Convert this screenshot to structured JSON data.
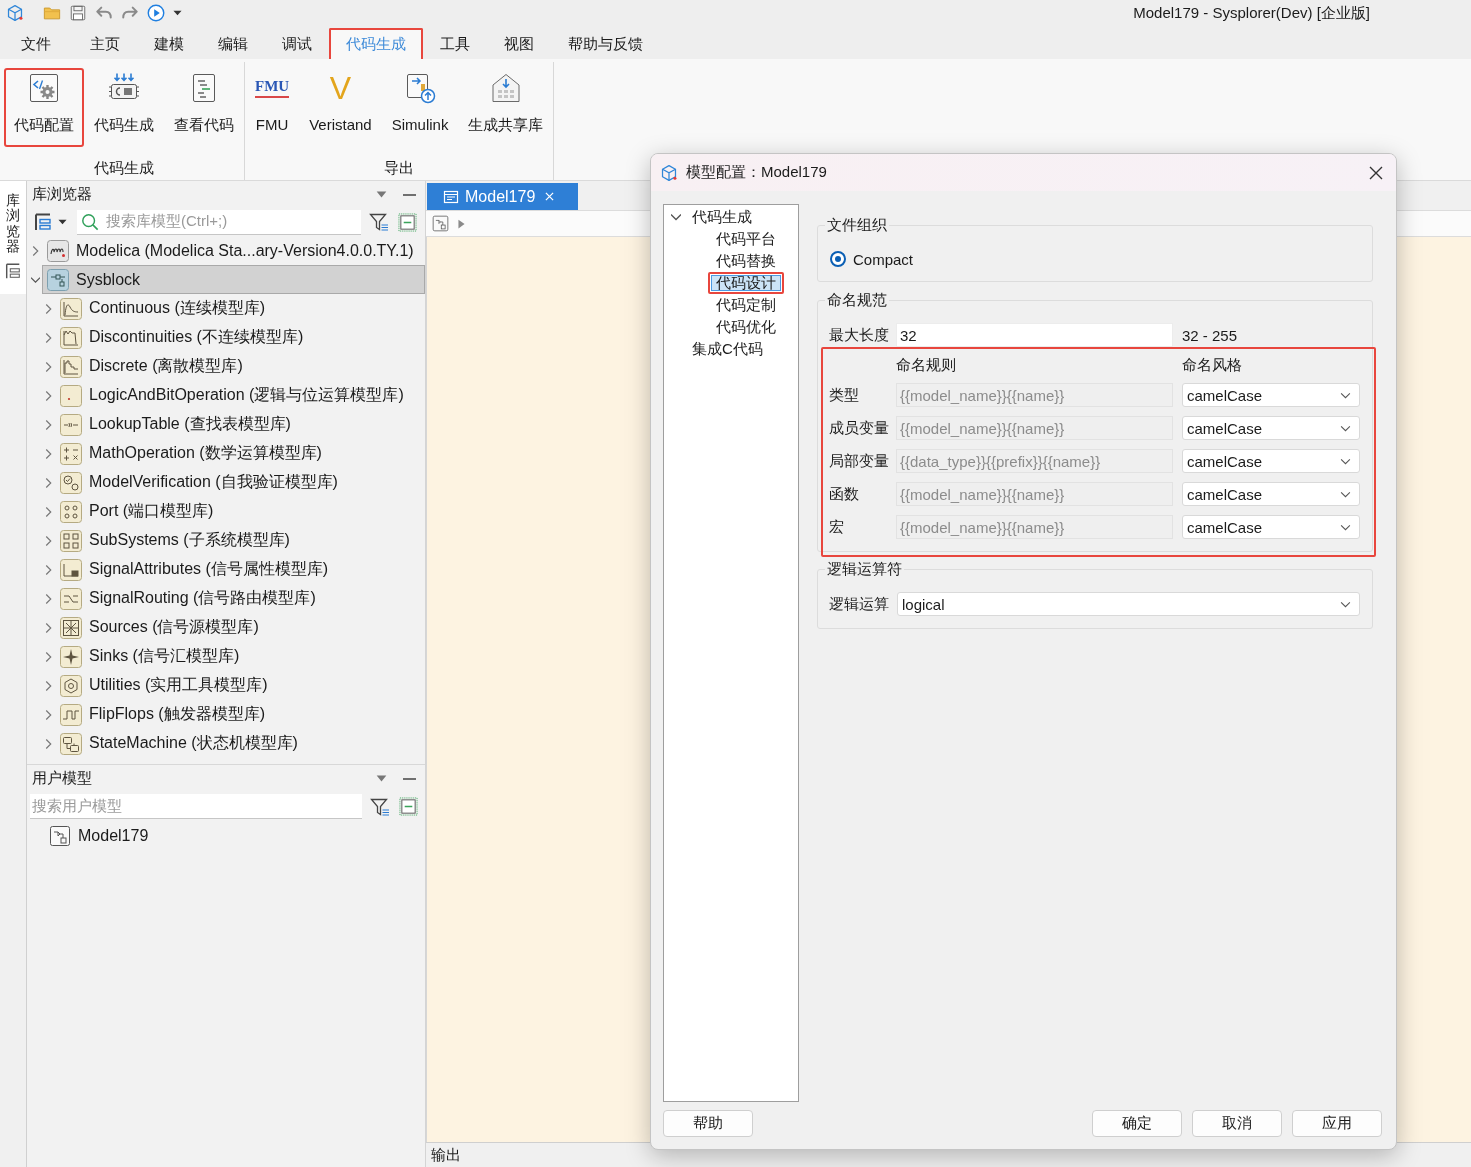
{
  "window": {
    "title": "Model179 - Sysplorer(Dev) [企业版]"
  },
  "menu_tabs": [
    {
      "label": "文件",
      "selected": false,
      "highlighted": false
    },
    {
      "label": "主页",
      "selected": false,
      "highlighted": false
    },
    {
      "label": "建模",
      "selected": false,
      "highlighted": false
    },
    {
      "label": "编辑",
      "selected": false,
      "highlighted": false
    },
    {
      "label": "调试",
      "selected": false,
      "highlighted": false
    },
    {
      "label": "代码生成",
      "selected": true,
      "highlighted": true
    },
    {
      "label": "工具",
      "selected": false,
      "highlighted": false
    },
    {
      "label": "视图",
      "selected": false,
      "highlighted": false
    },
    {
      "label": "帮助与反馈",
      "selected": false,
      "highlighted": false
    }
  ],
  "ribbon": {
    "groups": [
      {
        "label": "代码生成",
        "buttons": [
          {
            "label": "代码配置",
            "kind": "code_config",
            "highlighted": true
          },
          {
            "label": "代码生成",
            "kind": "code_generate",
            "highlighted": false
          },
          {
            "label": "查看代码",
            "kind": "view_code",
            "highlighted": false
          }
        ]
      },
      {
        "label": "导出",
        "buttons": [
          {
            "label": "FMU",
            "kind": "fmu",
            "logo_text": "FMU",
            "highlighted": false
          },
          {
            "label": "Veristand",
            "kind": "veristand",
            "logo_text": "V",
            "highlighted": false
          },
          {
            "label": "Simulink",
            "kind": "simulink",
            "highlighted": false
          },
          {
            "label": "生成共享库",
            "kind": "shared_library",
            "highlighted": false
          }
        ]
      }
    ]
  },
  "side_strip": {
    "tab_label": "库浏览器"
  },
  "library_browser": {
    "title": "库浏览器",
    "search": {
      "placeholder": "搜索库模型(Ctrl+;)"
    },
    "tree": [
      {
        "label": "Modelica (Modelica Sta...ary-Version4.0.0.TY.1)",
        "kind": "modelica",
        "expanded": false,
        "selected": false
      },
      {
        "label": "Sysblock",
        "kind": "sysblock",
        "expanded": true,
        "selected": true,
        "children": [
          {
            "label": "Continuous (连续模型库)",
            "kind": "continuous",
            "expanded": false,
            "selected": false
          },
          {
            "label": "Discontinuities (不连续模型库)",
            "kind": "discontinuities",
            "expanded": false,
            "selected": false
          },
          {
            "label": "Discrete (离散模型库)",
            "kind": "discrete",
            "expanded": false,
            "selected": false
          },
          {
            "label": "LogicAndBitOperation (逻辑与位运算模型库)",
            "kind": "logic",
            "expanded": false,
            "selected": false
          },
          {
            "label": "LookupTable (查找表模型库)",
            "kind": "lookup",
            "expanded": false,
            "selected": false
          },
          {
            "label": "MathOperation (数学运算模型库)",
            "kind": "math",
            "expanded": false,
            "selected": false
          },
          {
            "label": "ModelVerification (自我验证模型库)",
            "kind": "verification",
            "expanded": false,
            "selected": false
          },
          {
            "label": "Port (端口模型库)",
            "kind": "port",
            "expanded": false,
            "selected": false
          },
          {
            "label": "SubSystems (子系统模型库)",
            "kind": "subsystems",
            "expanded": false,
            "selected": false
          },
          {
            "label": "SignalAttributes (信号属性模型库)",
            "kind": "signal_attributes",
            "expanded": false,
            "selected": false
          },
          {
            "label": "SignalRouting (信号路由模型库)",
            "kind": "signal_routing",
            "expanded": false,
            "selected": false
          },
          {
            "label": "Sources (信号源模型库)",
            "kind": "sources",
            "expanded": false,
            "selected": false
          },
          {
            "label": "Sinks (信号汇模型库)",
            "kind": "sinks",
            "expanded": false,
            "selected": false
          },
          {
            "label": "Utilities (实用工具模型库)",
            "kind": "utilities",
            "expanded": false,
            "selected": false
          },
          {
            "label": "FlipFlops (触发器模型库)",
            "kind": "flipflops",
            "expanded": false,
            "selected": false
          },
          {
            "label": "StateMachine (状态机模型库)",
            "kind": "state_machine",
            "expanded": false,
            "selected": false
          }
        ]
      }
    ]
  },
  "user_models": {
    "title": "用户模型",
    "search": {
      "placeholder": "搜索用户模型"
    },
    "items": [
      {
        "label": "Model179"
      }
    ]
  },
  "editor": {
    "tabs": [
      {
        "label": "Model179",
        "selected": true
      }
    ],
    "output_panel": {
      "title": "输出"
    }
  },
  "dialog": {
    "title": "模型配置：Model179",
    "nav": [
      {
        "label": "代码生成",
        "expanded": true,
        "selected": false,
        "highlighted": false,
        "children": [
          {
            "label": "代码平台",
            "selected": false,
            "highlighted": false
          },
          {
            "label": "代码替换",
            "selected": false,
            "highlighted": false
          },
          {
            "label": "代码设计",
            "selected": true,
            "highlighted": true
          },
          {
            "label": "代码定制",
            "selected": false,
            "highlighted": false
          },
          {
            "label": "代码优化",
            "selected": false,
            "highlighted": false
          }
        ]
      },
      {
        "label": "集成C代码",
        "selected": false,
        "highlighted": false
      }
    ],
    "file_organization": {
      "title": "文件组织",
      "options": [
        {
          "label": "Compact",
          "selected": true
        }
      ]
    },
    "naming": {
      "title": "命名规范",
      "max_length": {
        "label": "最大长度",
        "value": "32",
        "range": "32 - 255"
      },
      "table": {
        "highlighted": true,
        "columns": [
          "命名规则",
          "命名风格"
        ],
        "rows": [
          {
            "label": "类型",
            "rule": "{{model_name}}{{name}}",
            "rule_disabled": true,
            "style": "camelCase"
          },
          {
            "label": "成员变量",
            "rule": "{{model_name}}{{name}}",
            "rule_disabled": true,
            "style": "camelCase"
          },
          {
            "label": "局部变量",
            "rule": "{{data_type}}{{prefix}}{{name}}",
            "rule_disabled": true,
            "style": "camelCase"
          },
          {
            "label": "函数",
            "rule": "{{model_name}}{{name}}",
            "rule_disabled": true,
            "style": "camelCase"
          },
          {
            "label": "宏",
            "rule": "{{model_name}}{{name}}",
            "rule_disabled": true,
            "style": "camelCase"
          }
        ]
      }
    },
    "logic_operators": {
      "title": "逻辑运算符",
      "label": "逻辑运算",
      "value": "logical"
    },
    "footer": {
      "left_buttons": [
        "帮助"
      ],
      "right_buttons": [
        "确定",
        "取消",
        "应用"
      ]
    }
  }
}
